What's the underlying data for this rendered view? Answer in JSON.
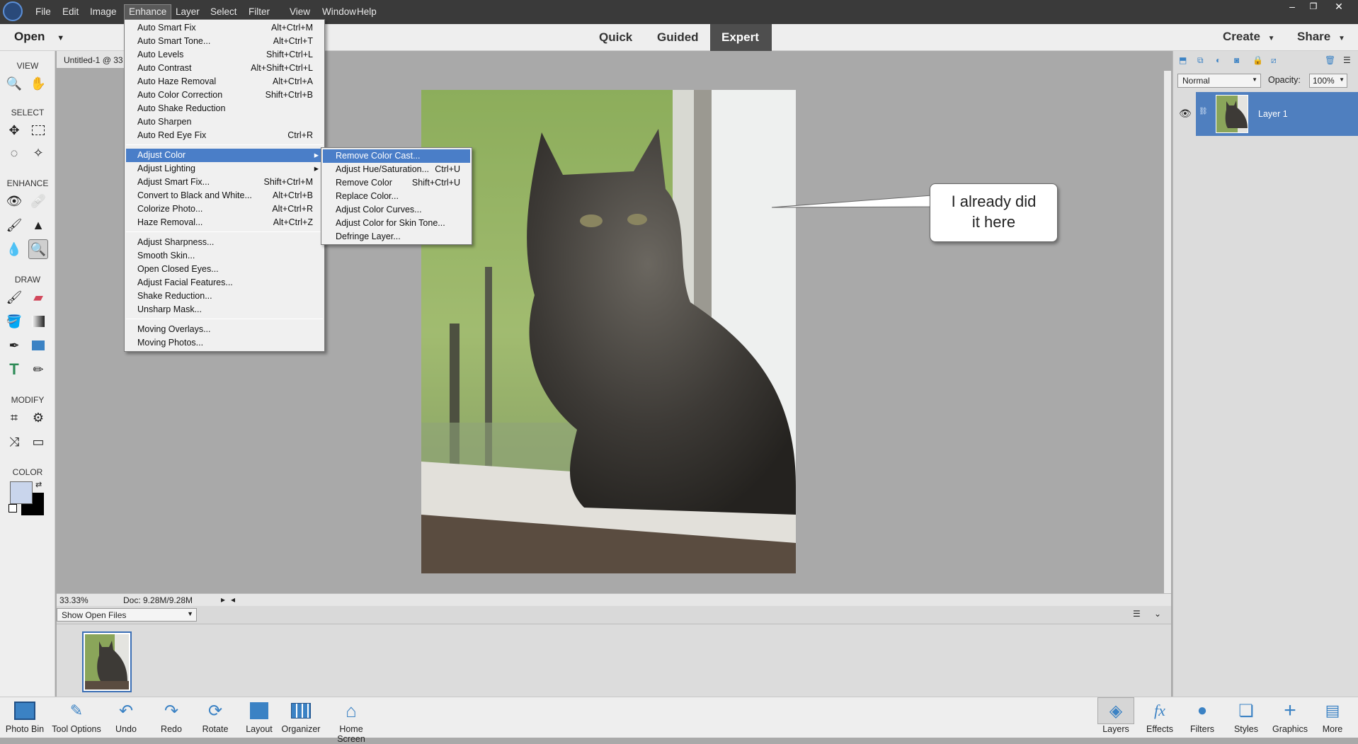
{
  "menubar": {
    "items": [
      "File",
      "Edit",
      "Image",
      "Enhance",
      "Layer",
      "Select",
      "Filter",
      "View",
      "Window",
      "Help"
    ],
    "active": "Enhance",
    "window_buttons": [
      "–",
      "❐",
      "✕"
    ]
  },
  "modebar": {
    "open_label": "Open",
    "modes": [
      "Quick",
      "Guided",
      "Expert"
    ],
    "selected_mode": "Expert",
    "create_label": "Create",
    "share_label": "Share"
  },
  "toolbox": {
    "sections": [
      "VIEW",
      "SELECT",
      "ENHANCE",
      "DRAW",
      "MODIFY",
      "COLOR"
    ]
  },
  "document": {
    "tab_title": "Untitled-1 @ 33"
  },
  "callout": {
    "line1": "I already did",
    "line2": "it here"
  },
  "statusbar": {
    "zoom": "33.33%",
    "doc_info": "Doc: 9.28M/9.28M"
  },
  "photo_bin": {
    "selector_value": "Show Open Files"
  },
  "layers_panel": {
    "blend_mode": "Normal",
    "opacity_label": "Opacity:",
    "opacity_value": "100%",
    "layer_name": "Layer 1"
  },
  "enhance_menu": {
    "group1": [
      {
        "label": "Auto Smart Fix",
        "shortcut": "Alt+Ctrl+M"
      },
      {
        "label": "Auto Smart Tone...",
        "shortcut": "Alt+Ctrl+T"
      },
      {
        "label": "Auto Levels",
        "shortcut": "Shift+Ctrl+L"
      },
      {
        "label": "Auto Contrast",
        "shortcut": "Alt+Shift+Ctrl+L"
      },
      {
        "label": "Auto Haze Removal",
        "shortcut": "Alt+Ctrl+A"
      },
      {
        "label": "Auto Color Correction",
        "shortcut": "Shift+Ctrl+B"
      },
      {
        "label": "Auto Shake Reduction",
        "shortcut": ""
      },
      {
        "label": "Auto Sharpen",
        "shortcut": ""
      },
      {
        "label": "Auto Red Eye Fix",
        "shortcut": "Ctrl+R"
      }
    ],
    "group2": [
      {
        "label": "Adjust Color",
        "shortcut": ""
      },
      {
        "label": "Adjust Lighting",
        "shortcut": ""
      },
      {
        "label": "Adjust Smart Fix...",
        "shortcut": "Shift+Ctrl+M"
      },
      {
        "label": "Convert to Black and White...",
        "shortcut": "Alt+Ctrl+B"
      },
      {
        "label": "Colorize Photo...",
        "shortcut": "Alt+Ctrl+R"
      },
      {
        "label": "Haze Removal...",
        "shortcut": "Alt+Ctrl+Z"
      }
    ],
    "group3": [
      {
        "label": "Adjust Sharpness...",
        "shortcut": ""
      },
      {
        "label": "Smooth Skin...",
        "shortcut": ""
      },
      {
        "label": "Open Closed Eyes...",
        "shortcut": ""
      },
      {
        "label": "Adjust Facial Features...",
        "shortcut": ""
      },
      {
        "label": "Shake Reduction...",
        "shortcut": ""
      },
      {
        "label": "Unsharp Mask...",
        "shortcut": ""
      }
    ],
    "group4": [
      {
        "label": "Moving Overlays...",
        "shortcut": ""
      },
      {
        "label": "Moving Photos...",
        "shortcut": ""
      }
    ],
    "highlighted": "Adjust Color"
  },
  "adjust_color_submenu": {
    "items": [
      {
        "label": "Remove Color Cast...",
        "shortcut": ""
      },
      {
        "label": "Adjust Hue/Saturation...",
        "shortcut": "Ctrl+U"
      },
      {
        "label": "Remove Color",
        "shortcut": "Shift+Ctrl+U"
      },
      {
        "label": "Replace Color...",
        "shortcut": ""
      },
      {
        "label": "Adjust Color Curves...",
        "shortcut": ""
      },
      {
        "label": "Adjust Color for Skin Tone...",
        "shortcut": ""
      },
      {
        "label": "Defringe Layer...",
        "shortcut": ""
      }
    ],
    "highlighted": "Remove Color Cast..."
  },
  "taskbar": {
    "left": [
      "Photo Bin",
      "Tool Options",
      "Undo",
      "Redo",
      "Rotate",
      "Layout",
      "Organizer",
      "Home Screen"
    ],
    "right": [
      "Layers",
      "Effects",
      "Filters",
      "Styles",
      "Graphics",
      "More"
    ]
  },
  "colors": {
    "accent": "#4a7ec8",
    "menubar": "#3a3a3a",
    "layer_selected": "#4f7fbf"
  }
}
